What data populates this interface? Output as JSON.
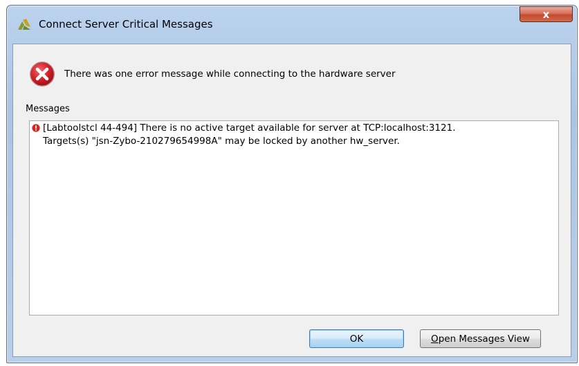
{
  "window": {
    "title": "Connect Server Critical Messages",
    "close_label": "x"
  },
  "header": {
    "message": "There was one error message while connecting to the hardware server"
  },
  "messages": {
    "label": "Messages",
    "items": [
      {
        "line1": "[Labtoolstcl 44-494] There is no active target available for server at TCP:localhost:3121.",
        "line2": "Targets(s) \"jsn-Zybo-210279654998A\" may be locked by another hw_server."
      }
    ]
  },
  "buttons": {
    "ok_label": "OK",
    "open_view_mnemonic": "O",
    "open_view_rest": "pen Messages View"
  },
  "icons": {
    "app": "vivado-logo-icon",
    "error": "error-icon",
    "message_severity": "critical-warning-icon",
    "close": "close-icon"
  },
  "colors": {
    "error_red": "#d2232a",
    "titlebar_blue": "#b9d1ee",
    "close_red": "#c94a32"
  }
}
